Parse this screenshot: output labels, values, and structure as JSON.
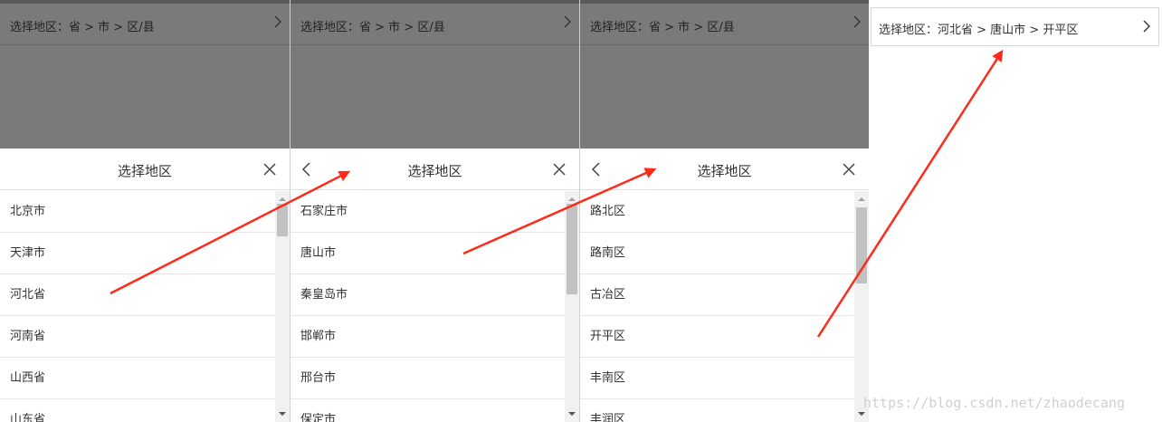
{
  "panel1": {
    "selector_prompt": "选择地区：省 > 市 > 区/县",
    "sheet_title": "选择地区",
    "items": [
      "北京市",
      "天津市",
      "河北省",
      "河南省",
      "山西省",
      "山东省"
    ]
  },
  "panel2": {
    "selector_prompt": "选择地区：省 > 市 > 区/县",
    "sheet_title": "选择地区",
    "items": [
      "石家庄市",
      "唐山市",
      "秦皇岛市",
      "邯郸市",
      "邢台市",
      "保定市"
    ]
  },
  "panel3": {
    "selector_prompt": "选择地区：省 > 市 > 区/县",
    "sheet_title": "选择地区",
    "items": [
      "路北区",
      "路南区",
      "古冶区",
      "开平区",
      "丰南区",
      "丰润区"
    ]
  },
  "panel4": {
    "selected_region": "选择地区：河北省 > 唐山市 > 开平区"
  },
  "watermark": "https://blog.csdn.net/zhaodecang",
  "colors": {
    "overlay": "#7a7a7a",
    "annotation_arrow": "#ff2a1a",
    "divider": "#e5e5e5"
  },
  "icons": {
    "selector_chevron": "chevron-right-icon",
    "back": "chevron-left-icon",
    "close": "close-icon"
  }
}
